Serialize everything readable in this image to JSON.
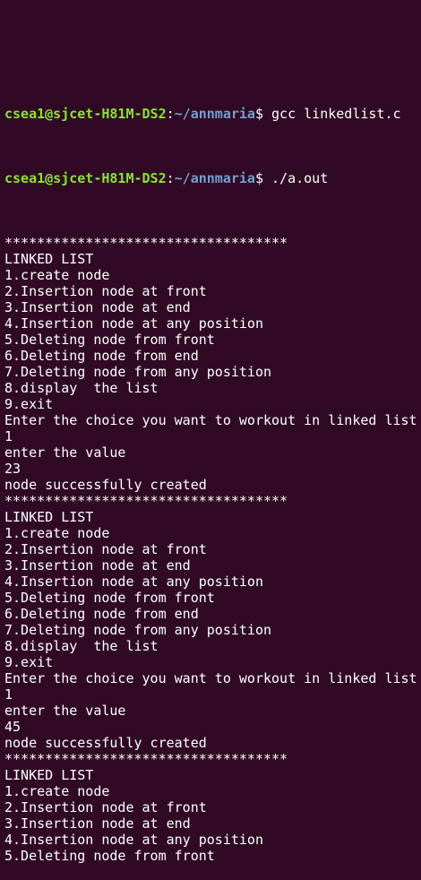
{
  "session": {
    "user_host": "csea1@sjcet-H81M-DS2",
    "path": "~/annmaria",
    "prompt_symbol": "$"
  },
  "commands": [
    {
      "user_host": "csea1@sjcet-H81M-DS2",
      "path": "~/annmaria",
      "symbol": "$",
      "text": " gcc linkedlist.c"
    },
    {
      "user_host": "csea1@sjcet-H81M-DS2",
      "path": "~/annmaria",
      "symbol": "$",
      "text": " ./a.out"
    }
  ],
  "output_lines": [
    "***********************************",
    "LINKED LIST",
    "1.create node",
    "2.Insertion node at front",
    "3.Insertion node at end",
    "4.Insertion node at any position",
    "5.Deleting node from front",
    "6.Deleting node from end",
    "7.Deleting node from any position",
    "8.display  the list",
    "9.exit",
    "Enter the choice you want to workout in linked list",
    "1",
    "enter the value",
    "23",
    "node successfully created",
    "***********************************",
    "LINKED LIST",
    "1.create node",
    "2.Insertion node at front",
    "3.Insertion node at end",
    "4.Insertion node at any position",
    "5.Deleting node from front",
    "6.Deleting node from end",
    "7.Deleting node from any position",
    "8.display  the list",
    "9.exit",
    "Enter the choice you want to workout in linked list",
    "1",
    "enter the value",
    "45",
    "node successfully created",
    "***********************************",
    "LINKED LIST",
    "1.create node",
    "2.Insertion node at front",
    "3.Insertion node at end",
    "4.Insertion node at any position",
    "5.Deleting node from front"
  ],
  "colors": {
    "background": "#300a24",
    "user_host": "#8ae234",
    "path": "#729fcf",
    "text": "#ffffff"
  }
}
